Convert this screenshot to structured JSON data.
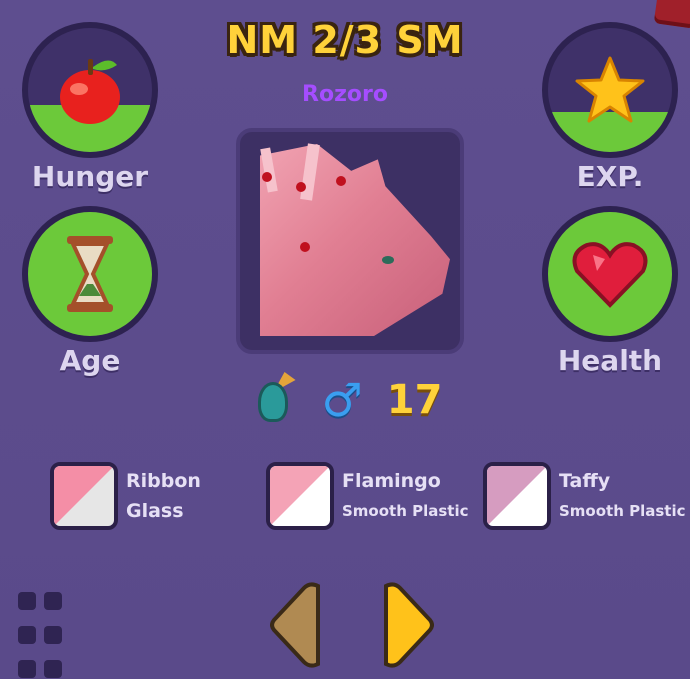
{
  "header": {
    "title": "NM 2/3 SM",
    "pet_name": "Rozoro"
  },
  "stats": {
    "hunger": {
      "label": "Hunger",
      "icon": "apple-icon",
      "fill": 0.38
    },
    "exp": {
      "label": "EXP.",
      "icon": "star-icon",
      "fill": 0.32
    },
    "age": {
      "label": "Age",
      "icon": "hourglass-icon",
      "fill": 1.0
    },
    "health": {
      "label": "Health",
      "icon": "heart-icon",
      "fill": 1.0
    }
  },
  "pet_info": {
    "species_icon": "dragon-icon",
    "gender_icon": "male-icon",
    "gender_symbol": "♂",
    "age_value": "17"
  },
  "colors": [
    {
      "name": "Ribbon",
      "material": "Glass",
      "color_a": "#f48ea6",
      "color_b": "#e6e6e6"
    },
    {
      "name": "Flamingo",
      "material": "Smooth Plastic",
      "color_a": "#f4a3b6",
      "color_b": "#ffffff"
    },
    {
      "name": "Taffy",
      "material": "Smooth Plastic",
      "color_a": "#d69cc0",
      "color_b": "#ffffff"
    }
  ],
  "theme": {
    "panel": "#5e4e8f",
    "accent_gold": "#ffd23a",
    "fill_green": "#6cc93a",
    "name_purple": "#a54dff"
  }
}
